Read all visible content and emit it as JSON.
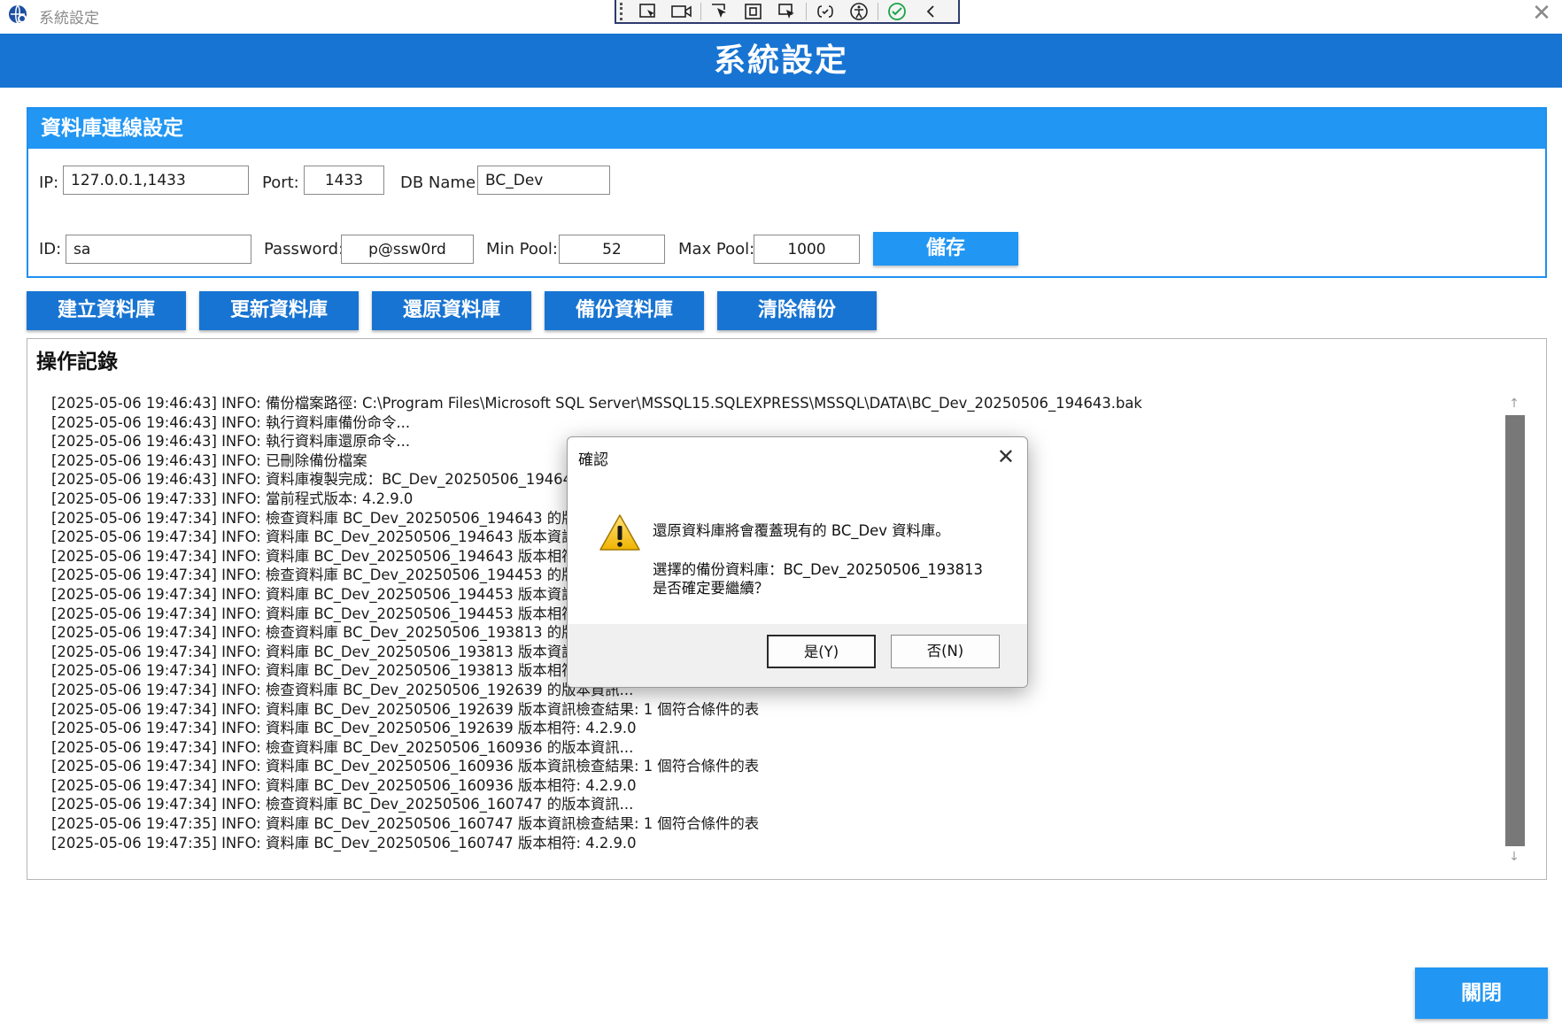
{
  "window": {
    "title": "系統設定",
    "close_glyph": "✕"
  },
  "header": {
    "title": "系統設定"
  },
  "db_section": {
    "title": "資料庫連線設定",
    "ip_label": "IP:",
    "ip_value": "127.0.0.1,1433",
    "port_label": "Port:",
    "port_value": "1433",
    "dbname_label": "DB Name:",
    "dbname_value": "BC_Dev",
    "id_label": "ID:",
    "id_value": "sa",
    "password_label": "Password:",
    "password_value": "p@ssw0rd",
    "minpool_label": "Min Pool:",
    "minpool_value": "52",
    "maxpool_label": "Max Pool:",
    "maxpool_value": "1000",
    "save_label": "儲存"
  },
  "actions": {
    "create_db": "建立資料庫",
    "update_db": "更新資料庫",
    "restore_db": "還原資料庫",
    "backup_db": "備份資料庫",
    "clear_backup": "清除備份"
  },
  "log": {
    "title": "操作記錄",
    "lines": [
      "[2025-05-06 19:46:43] INFO: 備份檔案路徑: C:\\Program Files\\Microsoft SQL Server\\MSSQL15.SQLEXPRESS\\MSSQL\\DATA\\BC_Dev_20250506_194643.bak",
      "[2025-05-06 19:46:43] INFO: 執行資料庫備份命令...",
      "[2025-05-06 19:46:43] INFO: 執行資料庫還原命令...",
      "[2025-05-06 19:46:43] INFO: 已刪除備份檔案",
      "[2025-05-06 19:46:43] INFO: 資料庫複製完成：BC_Dev_20250506_194643",
      "[2025-05-06 19:47:33] INFO: 當前程式版本: 4.2.9.0",
      "[2025-05-06 19:47:34] INFO: 檢查資料庫 BC_Dev_20250506_194643 的版本",
      "[2025-05-06 19:47:34] INFO: 資料庫 BC_Dev_20250506_194643 版本資訊",
      "[2025-05-06 19:47:34] INFO: 資料庫 BC_Dev_20250506_194643 版本相符:",
      "[2025-05-06 19:47:34] INFO: 檢查資料庫 BC_Dev_20250506_194453 的版本",
      "[2025-05-06 19:47:34] INFO: 資料庫 BC_Dev_20250506_194453 版本資訊",
      "[2025-05-06 19:47:34] INFO: 資料庫 BC_Dev_20250506_194453 版本相符:",
      "[2025-05-06 19:47:34] INFO: 檢查資料庫 BC_Dev_20250506_193813 的版本",
      "[2025-05-06 19:47:34] INFO: 資料庫 BC_Dev_20250506_193813 版本資訊",
      "[2025-05-06 19:47:34] INFO: 資料庫 BC_Dev_20250506_193813 版本相符:",
      "[2025-05-06 19:47:34] INFO: 檢查資料庫 BC_Dev_20250506_192639 的版本資訊...",
      "[2025-05-06 19:47:34] INFO: 資料庫 BC_Dev_20250506_192639 版本資訊檢查結果: 1 個符合條件的表",
      "[2025-05-06 19:47:34] INFO: 資料庫 BC_Dev_20250506_192639 版本相符: 4.2.9.0",
      "[2025-05-06 19:47:34] INFO: 檢查資料庫 BC_Dev_20250506_160936 的版本資訊...",
      "[2025-05-06 19:47:34] INFO: 資料庫 BC_Dev_20250506_160936 版本資訊檢查結果: 1 個符合條件的表",
      "[2025-05-06 19:47:34] INFO: 資料庫 BC_Dev_20250506_160936 版本相符: 4.2.9.0",
      "[2025-05-06 19:47:34] INFO: 檢查資料庫 BC_Dev_20250506_160747 的版本資訊...",
      "[2025-05-06 19:47:35] INFO: 資料庫 BC_Dev_20250506_160747 版本資訊檢查結果: 1 個符合條件的表",
      "[2025-05-06 19:47:35] INFO: 資料庫 BC_Dev_20250506_160747 版本相符: 4.2.9.0"
    ]
  },
  "dialog": {
    "title": "確認",
    "message_line1": "還原資料庫將會覆蓋現有的 BC_Dev 資料庫。",
    "message_line2": "選擇的備份資料庫：BC_Dev_20250506_193813",
    "message_line3": "是否確定要繼續？",
    "yes_label": "是(Y)",
    "no_label": "否(N)",
    "icon": "warning-icon"
  },
  "footer": {
    "close_label": "關閉"
  },
  "colors": {
    "header_blue": "#1874d2",
    "section_blue": "#2196f3"
  }
}
